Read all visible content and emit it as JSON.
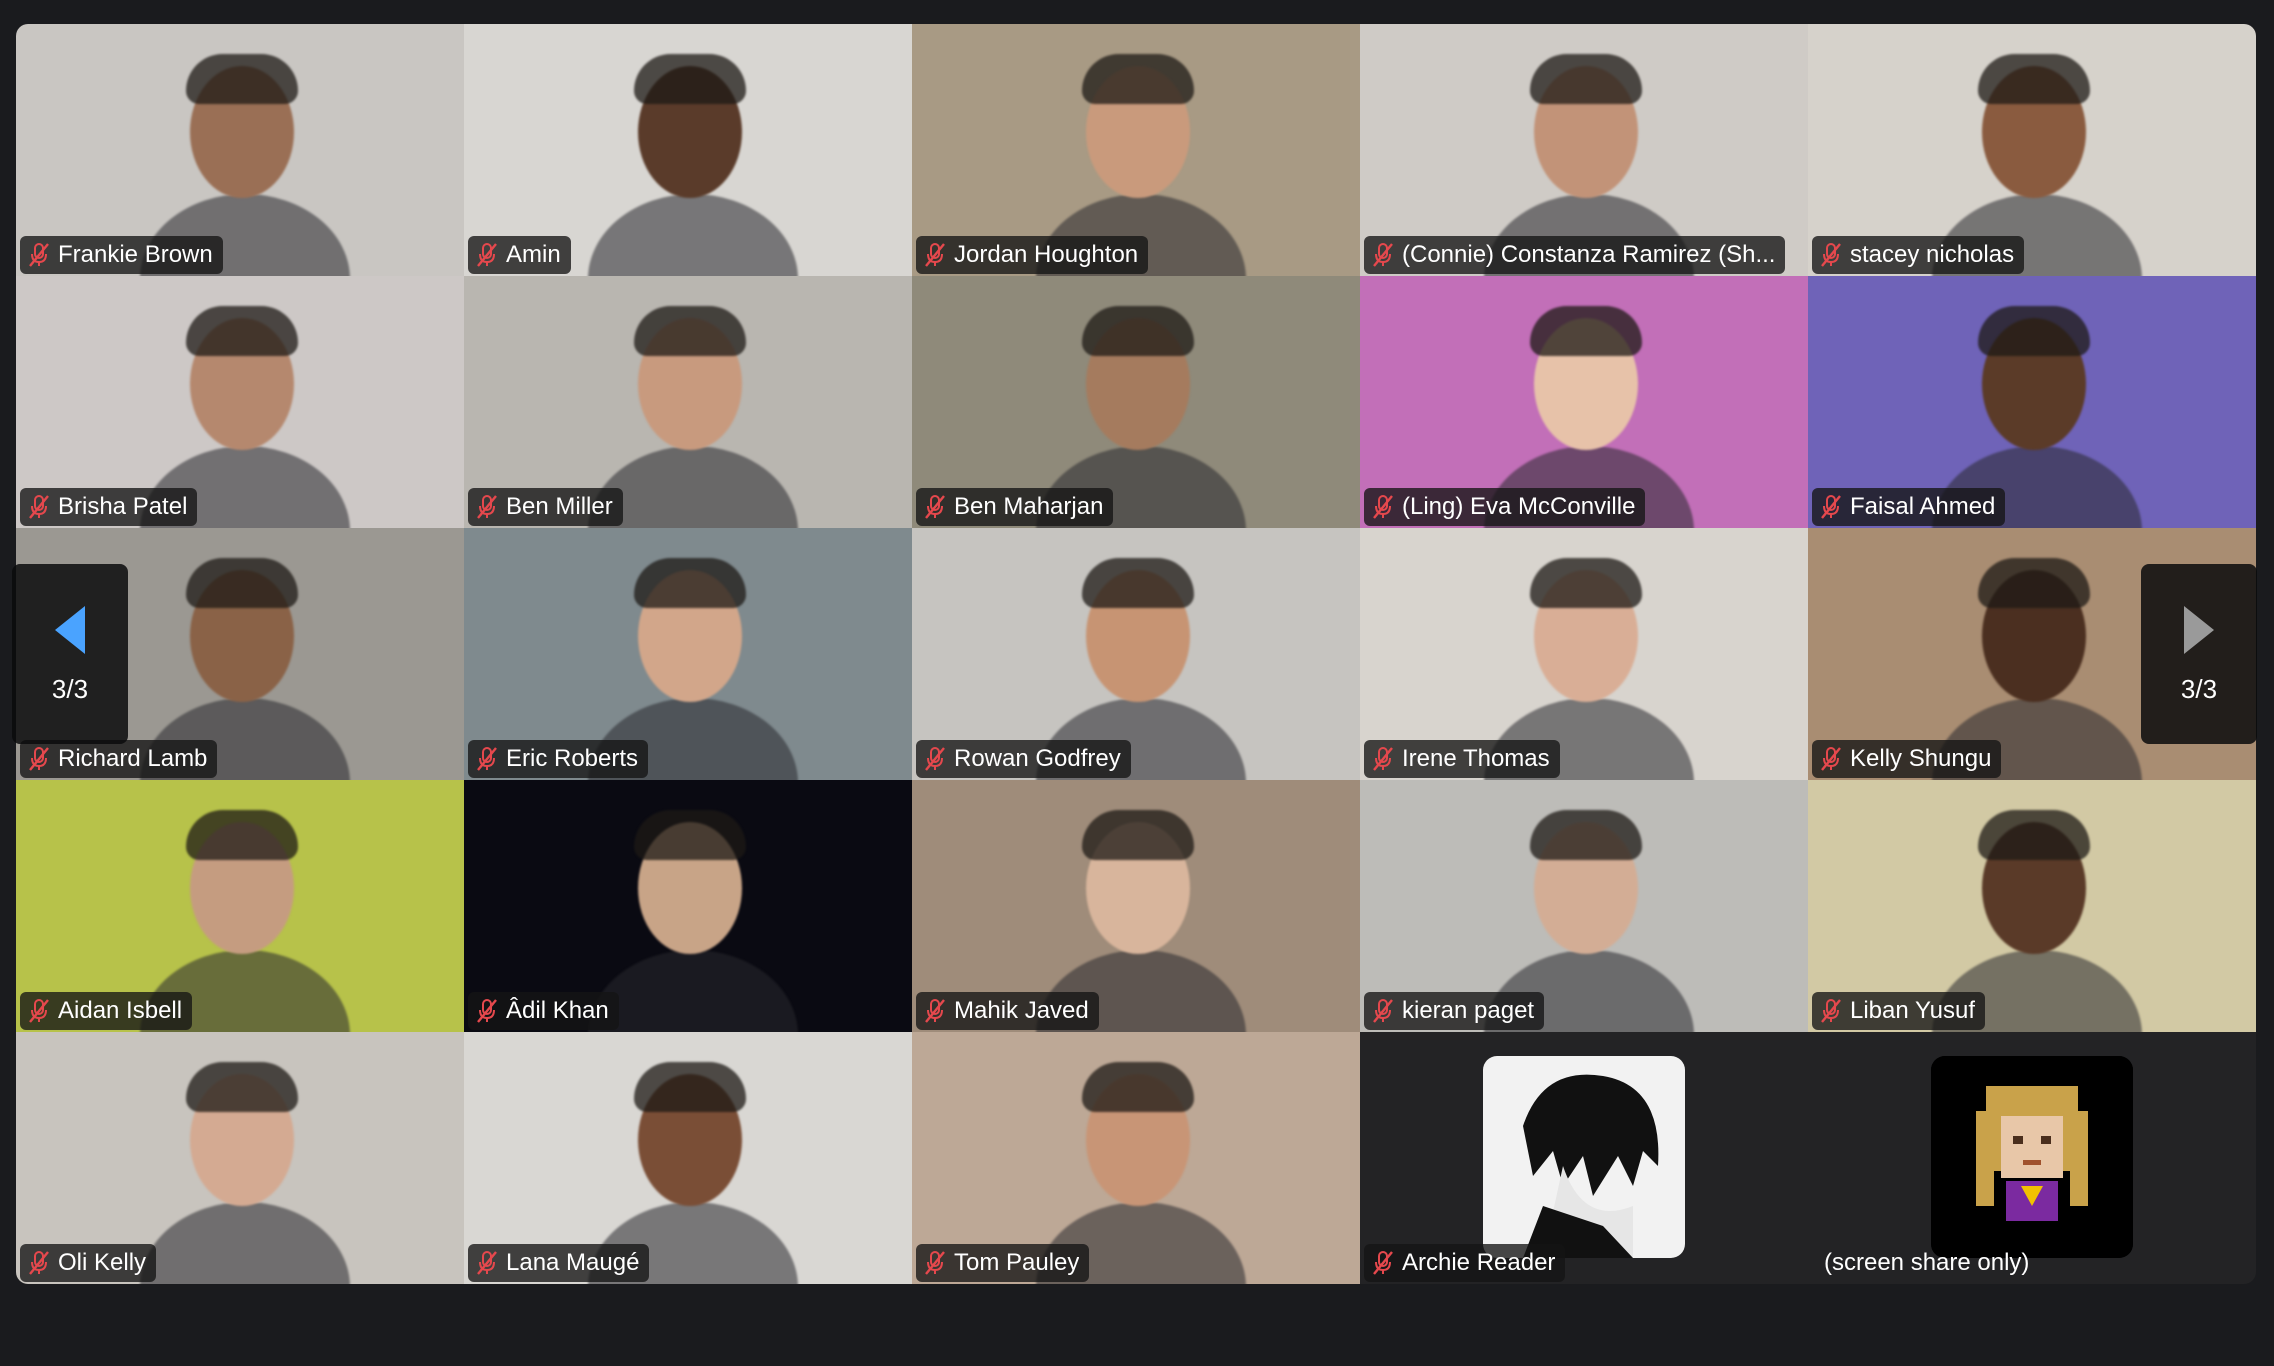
{
  "pager": {
    "left_label": "3/3",
    "right_label": "3/3"
  },
  "participants": [
    {
      "name": "Frankie Brown",
      "muted": true,
      "bg": "#c9c6c2",
      "skin": "#9a6f55"
    },
    {
      "name": "Amin",
      "muted": true,
      "bg": "#d8d6d2",
      "skin": "#5a3b2a"
    },
    {
      "name": "Jordan Houghton",
      "muted": true,
      "bg": "#a89a84",
      "skin": "#c99a7c"
    },
    {
      "name": "(Connie) Constanza Ramirez (Sh...",
      "muted": true,
      "bg": "#cfcbc6",
      "skin": "#c29378"
    },
    {
      "name": "stacey nicholas",
      "muted": true,
      "bg": "#d6d2cb",
      "skin": "#8a5b3f"
    },
    {
      "name": "Brisha Patel",
      "muted": true,
      "bg": "#cdc8c6",
      "skin": "#b5886e"
    },
    {
      "name": "Ben Miller",
      "muted": true,
      "bg": "#b9b6b0",
      "skin": "#c89a7e"
    },
    {
      "name": "Ben Maharjan",
      "muted": true,
      "bg": "#8f8a7a",
      "skin": "#a57b5e"
    },
    {
      "name": "(Ling) Eva McConville",
      "muted": true,
      "bg": "#c26fb8",
      "skin": "#e7c2a9"
    },
    {
      "name": "Faisal Ahmed",
      "muted": true,
      "bg": "#6f63b8",
      "skin": "#5b3b28"
    },
    {
      "name": "Richard Lamb",
      "muted": true,
      "bg": "#9b9892",
      "skin": "#8a6247"
    },
    {
      "name": "Eric Roberts",
      "muted": true,
      "bg": "#7f8a8e",
      "skin": "#d2a68a"
    },
    {
      "name": "Rowan Godfrey",
      "muted": true,
      "bg": "#c6c4c0",
      "skin": "#c79473"
    },
    {
      "name": "Irene Thomas",
      "muted": true,
      "bg": "#d8d4ce",
      "skin": "#d9ae96"
    },
    {
      "name": "Kelly Shungu",
      "muted": true,
      "bg": "#a98d72",
      "skin": "#4b2f20"
    },
    {
      "name": "Aidan Isbell",
      "muted": true,
      "bg": "#b7c24a",
      "skin": "#c59c80"
    },
    {
      "name": "Âdil Khan",
      "muted": true,
      "bg": "#0a0a12",
      "skin": "#c8a487"
    },
    {
      "name": "Mahik Javed",
      "muted": true,
      "bg": "#9f8c7a",
      "skin": "#d8b59c"
    },
    {
      "name": "kieran paget",
      "muted": true,
      "bg": "#bdbcb8",
      "skin": "#d3ad95"
    },
    {
      "name": "Liban Yusuf",
      "muted": true,
      "bg": "#d2c9a4",
      "skin": "#5a3a28"
    },
    {
      "name": "Oli Kelly",
      "muted": true,
      "bg": "#c8c4be",
      "skin": "#d4aa92"
    },
    {
      "name": "Lana Maugé",
      "muted": true,
      "bg": "#d9d7d3",
      "skin": "#7a4e36"
    },
    {
      "name": "Tom Pauley",
      "muted": true,
      "bg": "#bda896",
      "skin": "#c89576"
    },
    {
      "name": "Archie Reader",
      "muted": true,
      "bg": "#232325",
      "avatar": "anime-avatar"
    },
    {
      "name": "(screen share only)",
      "muted": false,
      "bg": "#232325",
      "avatar": "pixel-avatar"
    }
  ]
}
